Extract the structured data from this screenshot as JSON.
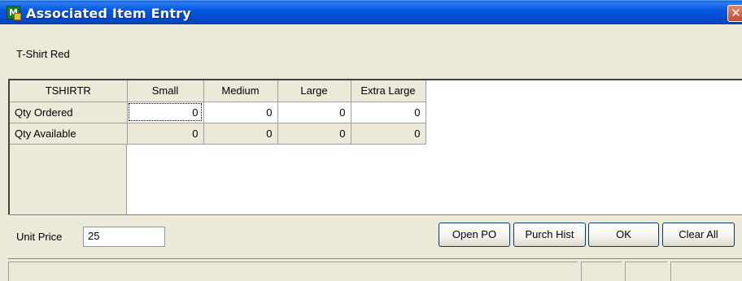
{
  "window": {
    "title": "Associated Item Entry",
    "close_glyph": "✕"
  },
  "item": {
    "description": "T-Shirt Red"
  },
  "grid": {
    "corner": "TSHIRTR",
    "columns": [
      "Small",
      "Medium",
      "Large",
      "Extra Large"
    ],
    "rows": [
      {
        "label": "Qty Ordered",
        "values": [
          "0",
          "0",
          "0",
          "0"
        ]
      },
      {
        "label": "Qty Available",
        "values": [
          "0",
          "0",
          "0",
          "0"
        ]
      }
    ]
  },
  "unit_price": {
    "label": "Unit Price",
    "value": "25"
  },
  "buttons": {
    "open_po": "Open PO",
    "purch_hist": "Purch Hist",
    "ok": "OK",
    "clear_all": "Clear All"
  },
  "icons": {
    "app": "module-icon",
    "close": "close-icon"
  },
  "colors": {
    "titlebar": "#0558df",
    "dialog_bg": "#ece9d8",
    "close_button": "#c44b2a"
  }
}
